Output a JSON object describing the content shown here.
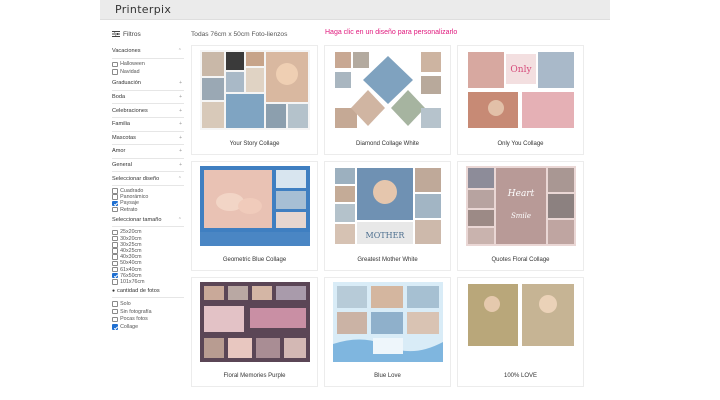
{
  "app": {
    "logo": "Printerpix"
  },
  "filters": {
    "title": "Filtros",
    "sections": {
      "vacaciones": {
        "label": "Vacaciones",
        "options": [
          {
            "label": "Halloween",
            "checked": false
          },
          {
            "label": "Navidad",
            "checked": false
          }
        ]
      },
      "graduacion": "Graduación",
      "boda": "Boda",
      "celebraciones": "Celebraciones",
      "familia": "Familia",
      "mascotas": "Mascotas",
      "amor": "Amor",
      "general": "General",
      "diseno": {
        "label": "Seleccionar diseño",
        "options": [
          {
            "label": "Cuadrado",
            "checked": false
          },
          {
            "label": "Panorámico",
            "checked": false
          },
          {
            "label": "Paysaje",
            "checked": true
          },
          {
            "label": "Retrato",
            "checked": false
          }
        ]
      },
      "tamano": {
        "label": "Seleccionar tamaño",
        "options": [
          {
            "label": "25x20cm",
            "checked": false
          },
          {
            "label": "30x20cm",
            "checked": false
          },
          {
            "label": "30x25cm",
            "checked": false
          },
          {
            "label": "40x25cm",
            "checked": false
          },
          {
            "label": "40x30cm",
            "checked": false
          },
          {
            "label": "50x40cm",
            "checked": false
          },
          {
            "label": "61x40cm",
            "checked": false
          },
          {
            "label": "76x50cm",
            "checked": true
          },
          {
            "label": "101x76cm",
            "checked": false
          }
        ]
      },
      "fotos": {
        "label": "cantidad de fotos",
        "options": [
          {
            "label": "Solo",
            "checked": false
          },
          {
            "label": "Sin fotografía",
            "checked": false
          },
          {
            "label": "Pocas fotos",
            "checked": false
          },
          {
            "label": "Collage",
            "checked": true
          }
        ]
      }
    }
  },
  "breadcrumb": "Todas 76cm x 50cm Foto-lienzos",
  "promo": "Haga clic en un diseño para personalizarlo",
  "products": [
    {
      "name": "Your Story Collage"
    },
    {
      "name": "Diamond Collage White"
    },
    {
      "name": "Only You Collage"
    },
    {
      "name": "Geometric Blue Collage"
    },
    {
      "name": "Greatest Mother White"
    },
    {
      "name": "Quotes Floral Collage"
    },
    {
      "name": "Floral Memories Purple"
    },
    {
      "name": "Blue Love"
    },
    {
      "name": "100% LOVE"
    }
  ],
  "colors": {
    "accent": "#e0197d",
    "checkbox": "#1f6fd1",
    "topbar": "#ebebeb"
  }
}
